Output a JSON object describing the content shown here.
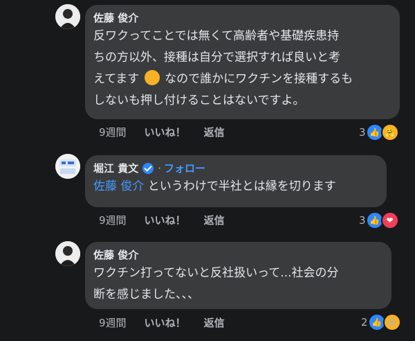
{
  "comments": [
    {
      "author": "佐藤 俊介",
      "lines": [
        "反ワクってことでは無くて高齢者や基礎疾患持",
        "ちの方以外、接種は自分で選択すれば良いと考",
        "えてます",
        "なので誰かにワクチンを接種するも",
        "しないも押し付けることはないですよ。"
      ],
      "inline_emoji": "sweat-smile-emoji",
      "time": "9週間",
      "like_label": "いいね！",
      "reply_label": "返信",
      "reaction_count": "3",
      "reactions": [
        "like",
        "care"
      ]
    },
    {
      "author": "堀江 貴文",
      "verified": true,
      "follow_label": "フォロー",
      "mention": "佐藤 俊介",
      "text": " というわけで半社とは縁を切ります",
      "time": "9週間",
      "like_label": "いいね！",
      "reply_label": "返信",
      "reaction_count": "3",
      "reactions": [
        "like",
        "love"
      ]
    },
    {
      "author": "佐藤 俊介",
      "lines": [
        "ワクチン打ってないと反社扱いって...社会の分",
        "断を感じました、、、"
      ],
      "time": "9週間",
      "like_label": "いいね！",
      "reply_label": "返信",
      "reaction_count": "2",
      "reactions": [
        "like",
        "haha"
      ]
    }
  ],
  "colors": {
    "background": "#18191a",
    "bubble": "#3a3b3c",
    "link": "#4599ff",
    "like": "#2d88ff",
    "love": "#f33e58",
    "emoji": "#f7b125"
  }
}
